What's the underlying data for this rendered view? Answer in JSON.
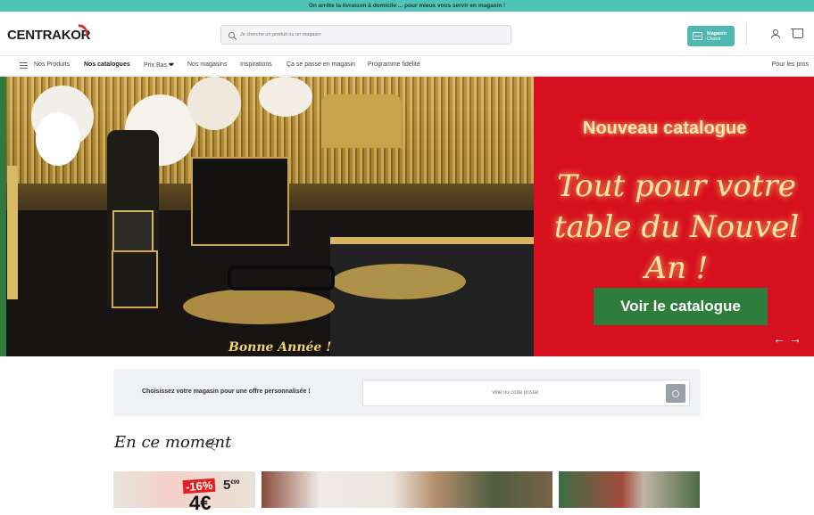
{
  "topbar": {
    "text": "On arrête la livraison à domicile ... pour mieux vous servir en magasin !"
  },
  "header": {
    "logo": "CENTRAKOR",
    "search_placeholder": "Je cherche un produit ou un magasin",
    "store_button": {
      "title": "Magasin",
      "subtitle": "Choisir"
    }
  },
  "nav": {
    "items": [
      "Nos Produits",
      "Nos catalogues",
      "Prix Bas",
      "Nos magasins",
      "Inspirations",
      "Ça se passe en magasin",
      "Programme fidélité"
    ],
    "right": "Pour les pros",
    "heart": "❤"
  },
  "hero": {
    "title": "Nouveau catalogue",
    "script": "Tout pour votre table du Nouvel An !",
    "cta": "Voir le catalogue",
    "photo_text": "Bonne Année !",
    "arrows": "←→"
  },
  "store_picker": {
    "label": "Choisissez votre magasin pour une offre personnalisée !",
    "placeholder": "Ville ou code postal"
  },
  "section": {
    "title": "En ce moment"
  },
  "promo_card": {
    "discount": "-16%",
    "old_price": "5",
    "old_cents": "€99",
    "new_price": "4€"
  },
  "colors": {
    "accent": "#4fc3b5",
    "hero_red": "#d6101e",
    "cta_green": "#2e7d3d"
  }
}
